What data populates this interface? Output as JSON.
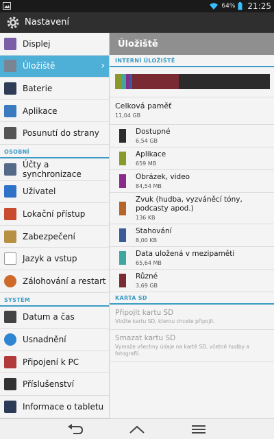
{
  "status": {
    "battery": "64%",
    "time": "21:25"
  },
  "app": {
    "title": "Nastavení"
  },
  "left": {
    "items_top": [
      {
        "label": "Displej",
        "icon": "display-icon",
        "color": "#7a5ea8"
      },
      {
        "label": "Úložiště",
        "icon": "storage-icon",
        "color": "#7a8593",
        "active": true
      },
      {
        "label": "Baterie",
        "icon": "battery-icon",
        "color": "#2e3c55"
      },
      {
        "label": "Aplikace",
        "icon": "apps-icon",
        "color": "#3a7bbf"
      },
      {
        "label": "Posunutí do strany",
        "icon": "side-swipe-icon",
        "color": "#555"
      }
    ],
    "section_personal": "OSOBNÍ",
    "items_personal": [
      {
        "label": "Účty a synchronizace",
        "icon": "accounts-icon",
        "color": "#556a86"
      },
      {
        "label": "Uživatel",
        "icon": "user-icon",
        "color": "#2f73c8"
      },
      {
        "label": "Lokační přístup",
        "icon": "location-icon",
        "color": "#c94a2e"
      },
      {
        "label": "Zabezpečení",
        "icon": "lock-icon",
        "color": "#b89044"
      },
      {
        "label": "Jazyk a vstup",
        "icon": "language-icon",
        "color": "#9a9a9a"
      },
      {
        "label": "Zálohování a restart",
        "icon": "backup-icon",
        "color": "#d06a2a"
      }
    ],
    "section_system": "SYSTÉM",
    "items_system": [
      {
        "label": "Datum a čas",
        "icon": "calendar-icon",
        "color": "#444"
      },
      {
        "label": "Usnadnění",
        "icon": "accessibility-icon",
        "color": "#2f86d0"
      },
      {
        "label": "Připojení k PC",
        "icon": "pc-connection-icon",
        "color": "#b33a3a"
      },
      {
        "label": "Příslušenství",
        "icon": "accessories-icon",
        "color": "#333"
      },
      {
        "label": "Informace o tabletu",
        "icon": "tablet-info-icon",
        "color": "#2c3a58"
      }
    ]
  },
  "right": {
    "header": "Úložiště",
    "section_internal": "INTERNÍ ÚLOŽIŠTĚ",
    "bar": [
      {
        "color": "#8a9a2a",
        "pct": 4
      },
      {
        "color": "#3fa6a0",
        "pct": 3
      },
      {
        "color": "#8a2a8a",
        "pct": 2
      },
      {
        "color": "#3a5a9a",
        "pct": 2
      },
      {
        "color": "#7a2a33",
        "pct": 30
      },
      {
        "color": "#2b2b2b",
        "pct": 59
      }
    ],
    "total_label": "Celková paměť",
    "total_value": "11,04 GB",
    "items": [
      {
        "name": "Dostupné",
        "size": "6,54 GB",
        "color": "#2b2b2b"
      },
      {
        "name": "Aplikace",
        "size": "659 MB",
        "color": "#8a9a2a"
      },
      {
        "name": "Obrázek, video",
        "size": "84,54 MB",
        "color": "#8a2a8a"
      },
      {
        "name": "Zvuk (hudba, vyzváněcí tóny, podcasty apod.)",
        "size": "136 KB",
        "color": "#b5652a"
      },
      {
        "name": "Stahování",
        "size": "8,00 KB",
        "color": "#3a5a9a"
      },
      {
        "name": "Data uložená v mezipaměti",
        "size": "65,64 MB",
        "color": "#3fa6a0"
      },
      {
        "name": "Různé",
        "size": "3,69 GB",
        "color": "#7a2a33"
      }
    ],
    "section_sd": "KARTA SD",
    "sd_mount": {
      "title": "Připojit kartu SD",
      "desc": "Vložte kartu SD, kterou chcete připojit."
    },
    "sd_erase": {
      "title": "Smazat kartu SD",
      "desc": "Vymaže všechny údaje na kartě SD, včetně hudby a fotografií."
    }
  }
}
